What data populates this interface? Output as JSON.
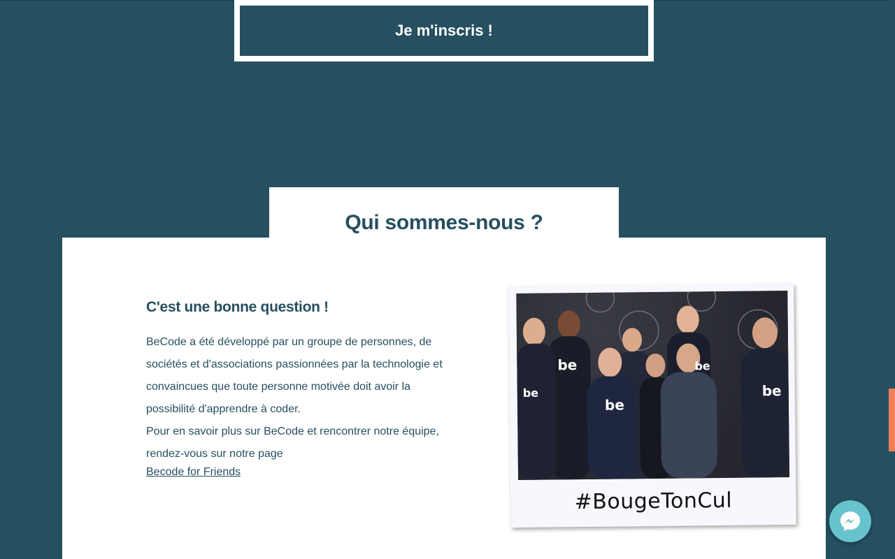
{
  "signup": {
    "label": "Je m'inscris !"
  },
  "section": {
    "title": "Qui sommes-nous ?"
  },
  "about": {
    "heading": "C'est une bonne question !",
    "paragraph1": "BeCode a été développé par un groupe de personnes, de sociétés et d'associations passionnées par la technologie et convaincues que toute personne motivée doit avoir la possibilité d'apprendre à coder.",
    "paragraph2": "Pour en savoir plus sur BeCode et rencontrer notre équipe, rendez-vous sur notre page",
    "link": "Becode for Friends"
  },
  "photo": {
    "caption": "#BougeTonCul"
  },
  "colors": {
    "primary": "#264f5f",
    "accent": "#ee7f5a",
    "messenger": "#67c4cf"
  },
  "icons": {
    "chat": "messenger-icon"
  }
}
